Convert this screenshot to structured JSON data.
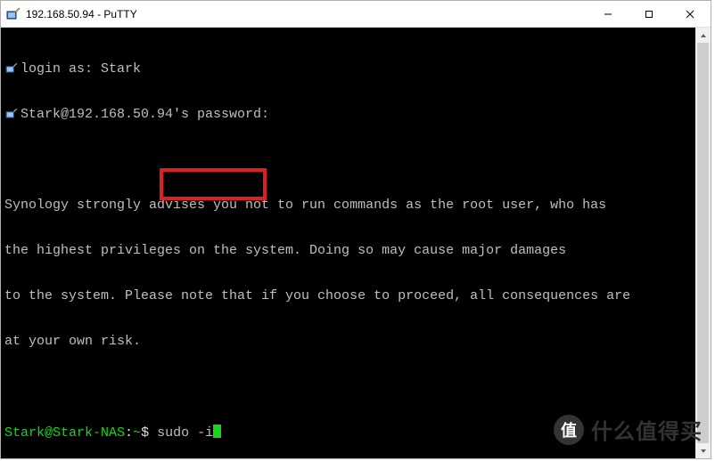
{
  "window": {
    "title": "192.168.50.94 - PuTTY"
  },
  "terminal": {
    "login_prompt": "login as: ",
    "login_user": "Stark",
    "password_prompt": "Stark@192.168.50.94's password:",
    "motd_line1": "Synology strongly advises you not to run commands as the root user, who has",
    "motd_line2": "the highest privileges on the system. Doing so may cause major damages",
    "motd_line3": "to the system. Please note that if you choose to proceed, all consequences are",
    "motd_line4": "at your own risk.",
    "prompt_user_host": "Stark@Stark-NAS",
    "prompt_sep": ":",
    "prompt_path": "~",
    "prompt_symbol": "$",
    "command": "sudo -i"
  },
  "watermark": {
    "logo_char": "值",
    "text": "什么值得买"
  },
  "chart_data": {
    "type": "table",
    "title": "PuTTY terminal session",
    "rows": [
      {
        "kind": "login_prompt",
        "text": "login as: Stark"
      },
      {
        "kind": "password_prompt",
        "text": "Stark@192.168.50.94's password:"
      },
      {
        "kind": "blank",
        "text": ""
      },
      {
        "kind": "motd",
        "text": "Synology strongly advises you not to run commands as the root user, who has"
      },
      {
        "kind": "motd",
        "text": "the highest privileges on the system. Doing so may cause major damages"
      },
      {
        "kind": "motd",
        "text": "to the system. Please note that if you choose to proceed, all consequences are"
      },
      {
        "kind": "motd",
        "text": "at your own risk."
      },
      {
        "kind": "blank",
        "text": ""
      },
      {
        "kind": "shell_prompt",
        "prompt": "Stark@Stark-NAS:~$",
        "command": "sudo -i",
        "highlighted": true
      }
    ]
  }
}
